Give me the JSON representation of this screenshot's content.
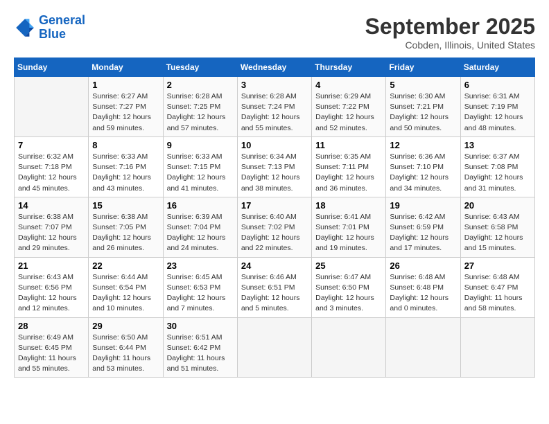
{
  "header": {
    "logo_line1": "General",
    "logo_line2": "Blue",
    "month": "September 2025",
    "location": "Cobden, Illinois, United States"
  },
  "days_of_week": [
    "Sunday",
    "Monday",
    "Tuesday",
    "Wednesday",
    "Thursday",
    "Friday",
    "Saturday"
  ],
  "weeks": [
    [
      {
        "day": "",
        "info": ""
      },
      {
        "day": "1",
        "info": "Sunrise: 6:27 AM\nSunset: 7:27 PM\nDaylight: 12 hours\nand 59 minutes."
      },
      {
        "day": "2",
        "info": "Sunrise: 6:28 AM\nSunset: 7:25 PM\nDaylight: 12 hours\nand 57 minutes."
      },
      {
        "day": "3",
        "info": "Sunrise: 6:28 AM\nSunset: 7:24 PM\nDaylight: 12 hours\nand 55 minutes."
      },
      {
        "day": "4",
        "info": "Sunrise: 6:29 AM\nSunset: 7:22 PM\nDaylight: 12 hours\nand 52 minutes."
      },
      {
        "day": "5",
        "info": "Sunrise: 6:30 AM\nSunset: 7:21 PM\nDaylight: 12 hours\nand 50 minutes."
      },
      {
        "day": "6",
        "info": "Sunrise: 6:31 AM\nSunset: 7:19 PM\nDaylight: 12 hours\nand 48 minutes."
      }
    ],
    [
      {
        "day": "7",
        "info": "Sunrise: 6:32 AM\nSunset: 7:18 PM\nDaylight: 12 hours\nand 45 minutes."
      },
      {
        "day": "8",
        "info": "Sunrise: 6:33 AM\nSunset: 7:16 PM\nDaylight: 12 hours\nand 43 minutes."
      },
      {
        "day": "9",
        "info": "Sunrise: 6:33 AM\nSunset: 7:15 PM\nDaylight: 12 hours\nand 41 minutes."
      },
      {
        "day": "10",
        "info": "Sunrise: 6:34 AM\nSunset: 7:13 PM\nDaylight: 12 hours\nand 38 minutes."
      },
      {
        "day": "11",
        "info": "Sunrise: 6:35 AM\nSunset: 7:11 PM\nDaylight: 12 hours\nand 36 minutes."
      },
      {
        "day": "12",
        "info": "Sunrise: 6:36 AM\nSunset: 7:10 PM\nDaylight: 12 hours\nand 34 minutes."
      },
      {
        "day": "13",
        "info": "Sunrise: 6:37 AM\nSunset: 7:08 PM\nDaylight: 12 hours\nand 31 minutes."
      }
    ],
    [
      {
        "day": "14",
        "info": "Sunrise: 6:38 AM\nSunset: 7:07 PM\nDaylight: 12 hours\nand 29 minutes."
      },
      {
        "day": "15",
        "info": "Sunrise: 6:38 AM\nSunset: 7:05 PM\nDaylight: 12 hours\nand 26 minutes."
      },
      {
        "day": "16",
        "info": "Sunrise: 6:39 AM\nSunset: 7:04 PM\nDaylight: 12 hours\nand 24 minutes."
      },
      {
        "day": "17",
        "info": "Sunrise: 6:40 AM\nSunset: 7:02 PM\nDaylight: 12 hours\nand 22 minutes."
      },
      {
        "day": "18",
        "info": "Sunrise: 6:41 AM\nSunset: 7:01 PM\nDaylight: 12 hours\nand 19 minutes."
      },
      {
        "day": "19",
        "info": "Sunrise: 6:42 AM\nSunset: 6:59 PM\nDaylight: 12 hours\nand 17 minutes."
      },
      {
        "day": "20",
        "info": "Sunrise: 6:43 AM\nSunset: 6:58 PM\nDaylight: 12 hours\nand 15 minutes."
      }
    ],
    [
      {
        "day": "21",
        "info": "Sunrise: 6:43 AM\nSunset: 6:56 PM\nDaylight: 12 hours\nand 12 minutes."
      },
      {
        "day": "22",
        "info": "Sunrise: 6:44 AM\nSunset: 6:54 PM\nDaylight: 12 hours\nand 10 minutes."
      },
      {
        "day": "23",
        "info": "Sunrise: 6:45 AM\nSunset: 6:53 PM\nDaylight: 12 hours\nand 7 minutes."
      },
      {
        "day": "24",
        "info": "Sunrise: 6:46 AM\nSunset: 6:51 PM\nDaylight: 12 hours\nand 5 minutes."
      },
      {
        "day": "25",
        "info": "Sunrise: 6:47 AM\nSunset: 6:50 PM\nDaylight: 12 hours\nand 3 minutes."
      },
      {
        "day": "26",
        "info": "Sunrise: 6:48 AM\nSunset: 6:48 PM\nDaylight: 12 hours\nand 0 minutes."
      },
      {
        "day": "27",
        "info": "Sunrise: 6:48 AM\nSunset: 6:47 PM\nDaylight: 11 hours\nand 58 minutes."
      }
    ],
    [
      {
        "day": "28",
        "info": "Sunrise: 6:49 AM\nSunset: 6:45 PM\nDaylight: 11 hours\nand 55 minutes."
      },
      {
        "day": "29",
        "info": "Sunrise: 6:50 AM\nSunset: 6:44 PM\nDaylight: 11 hours\nand 53 minutes."
      },
      {
        "day": "30",
        "info": "Sunrise: 6:51 AM\nSunset: 6:42 PM\nDaylight: 11 hours\nand 51 minutes."
      },
      {
        "day": "",
        "info": ""
      },
      {
        "day": "",
        "info": ""
      },
      {
        "day": "",
        "info": ""
      },
      {
        "day": "",
        "info": ""
      }
    ]
  ]
}
